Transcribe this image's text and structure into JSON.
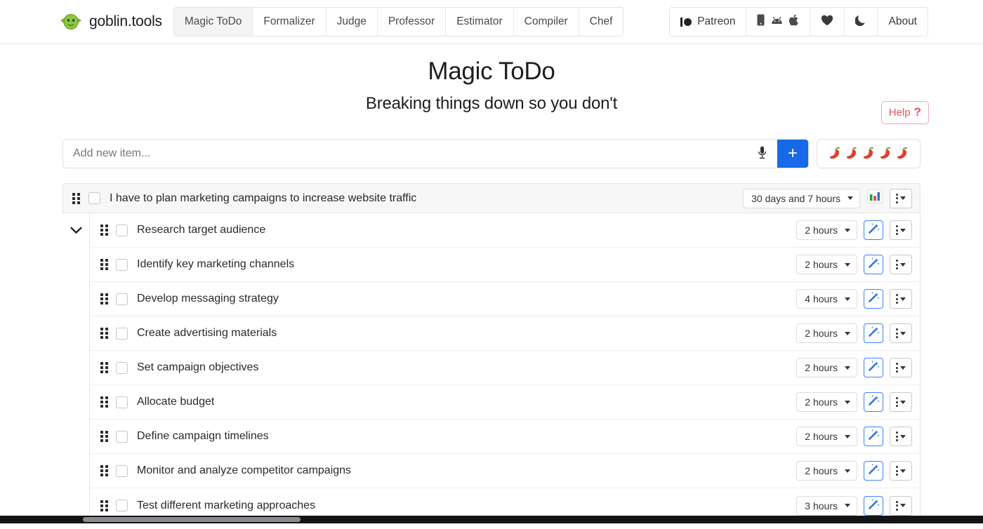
{
  "navbar": {
    "brand": {
      "name": "goblin.tools",
      "logo_icon": "goblin-head-icon"
    },
    "tabs": [
      {
        "label": "Magic ToDo",
        "active": true
      },
      {
        "label": "Formalizer",
        "active": false
      },
      {
        "label": "Judge",
        "active": false
      },
      {
        "label": "Professor",
        "active": false
      },
      {
        "label": "Estimator",
        "active": false
      },
      {
        "label": "Compiler",
        "active": false
      },
      {
        "label": "Chef",
        "active": false
      }
    ],
    "right": {
      "patreon_label": "Patreon",
      "platform_icons": [
        "phone-icon",
        "android-icon",
        "apple-icon"
      ],
      "heart_icon": "heart-icon",
      "moon_icon": "moon-icon",
      "about_label": "About"
    }
  },
  "page": {
    "title": "Magic ToDo",
    "subtitle": "Breaking things down so you don't",
    "help_label": "Help",
    "help_mark": "?"
  },
  "composer": {
    "placeholder": "Add new item...",
    "value": "",
    "mic_icon": "microphone-icon",
    "add_label": "+",
    "spice_level": 5,
    "pepper_icon": "chili-pepper-icon"
  },
  "colors": {
    "accent_blue": "#1769e8",
    "wand_blue": "#3b82f6",
    "help_red": "#e8505b",
    "goblin_green": "#7dc32b",
    "parent_row_bg": "#f7f7f8"
  },
  "task": {
    "text": "I have to plan marketing campaigns to increase website traffic",
    "duration": "30 days and 7 hours",
    "checked": false,
    "expanded": true,
    "chart_icon": "bar-chart-icon",
    "menu_icon": "kebab-menu-icon",
    "collapse_icon": "chevron-down-icon",
    "drag_icon": "drag-handle-icon",
    "subtasks": [
      {
        "text": "Research target audience",
        "duration": "2 hours",
        "checked": false
      },
      {
        "text": "Identify key marketing channels",
        "duration": "2 hours",
        "checked": false
      },
      {
        "text": "Develop messaging strategy",
        "duration": "4 hours",
        "checked": false
      },
      {
        "text": "Create advertising materials",
        "duration": "2 hours",
        "checked": false
      },
      {
        "text": "Set campaign objectives",
        "duration": "2 hours",
        "checked": false
      },
      {
        "text": "Allocate budget",
        "duration": "2 hours",
        "checked": false
      },
      {
        "text": "Define campaign timelines",
        "duration": "2 hours",
        "checked": false
      },
      {
        "text": "Monitor and analyze competitor campaigns",
        "duration": "2 hours",
        "checked": false
      },
      {
        "text": "Test different marketing approaches",
        "duration": "3 hours",
        "checked": false
      }
    ],
    "wand_icon": "magic-wand-icon"
  }
}
